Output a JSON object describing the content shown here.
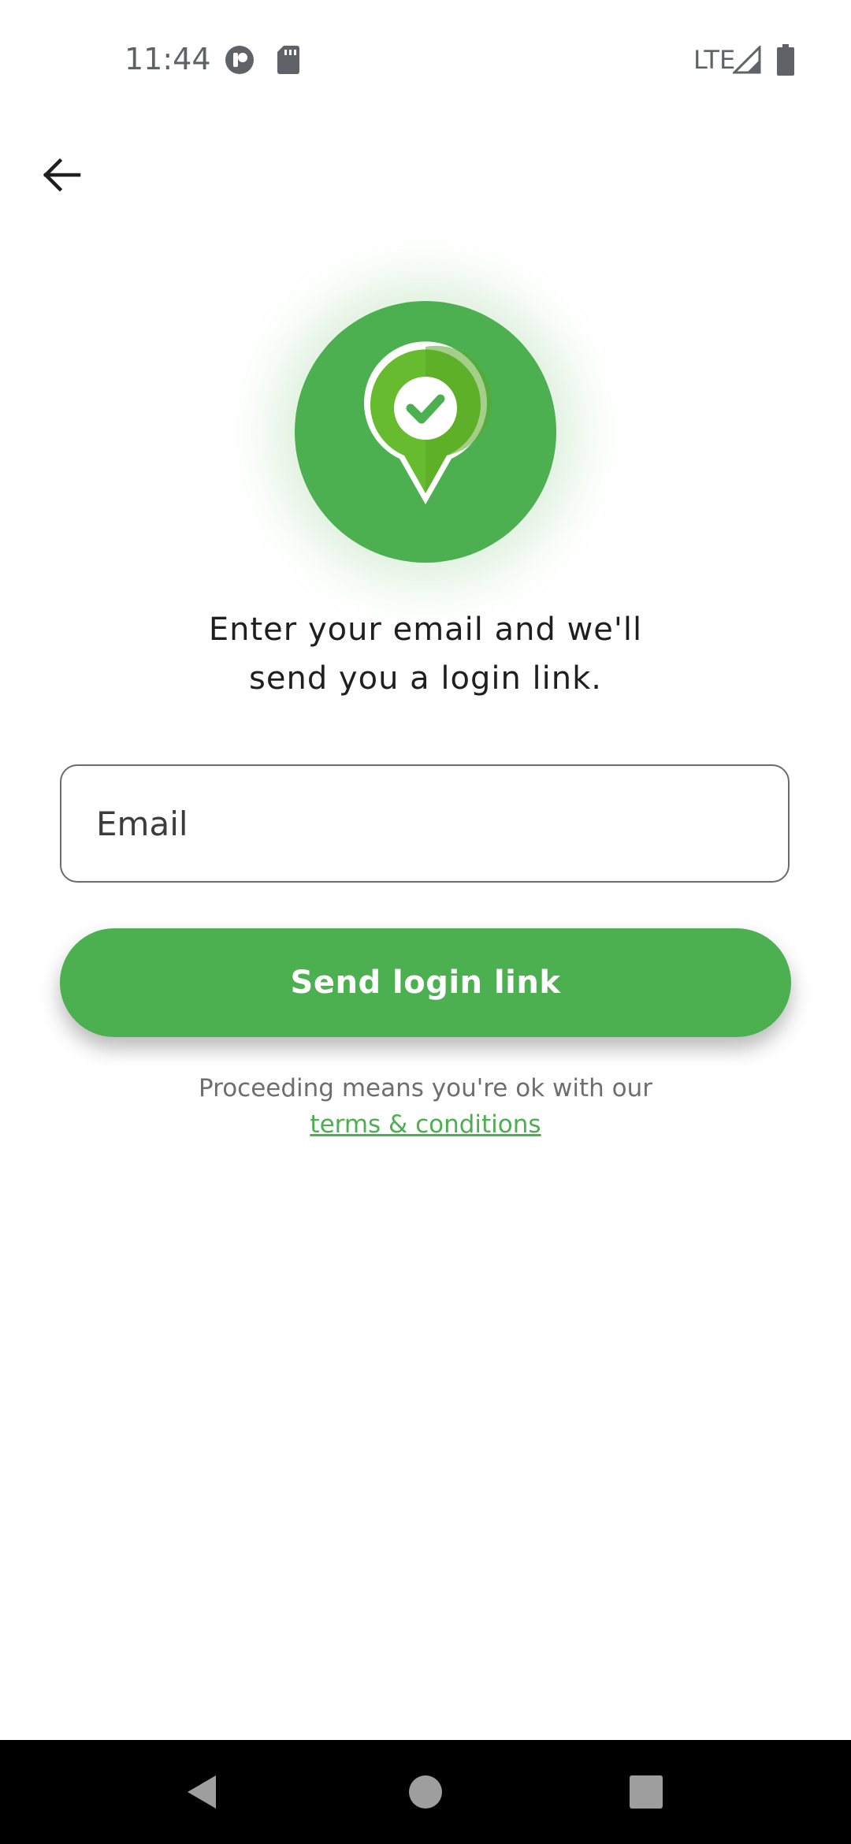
{
  "status_bar": {
    "time": "11:44",
    "network": "LTE",
    "icons": [
      "notification-app-icon",
      "sd-card-icon",
      "signal-icon",
      "battery-icon"
    ]
  },
  "header": {
    "back_icon": "arrow-left-icon"
  },
  "hero": {
    "icon": "location-pin-check-icon",
    "accent_color": "#4caf50"
  },
  "intro": {
    "line1": "Enter your email and we'll",
    "line2": "send you a login link."
  },
  "email": {
    "placeholder": "Email",
    "value": ""
  },
  "send_button": {
    "label": "Send login link",
    "color": "#4caf50"
  },
  "terms": {
    "text": "Proceeding means you're ok with our",
    "link_label": "terms & conditions",
    "link_color": "#4caf50"
  },
  "nav_bar": {
    "items": [
      "back-triangle-icon",
      "home-circle-icon",
      "recents-square-icon"
    ]
  }
}
